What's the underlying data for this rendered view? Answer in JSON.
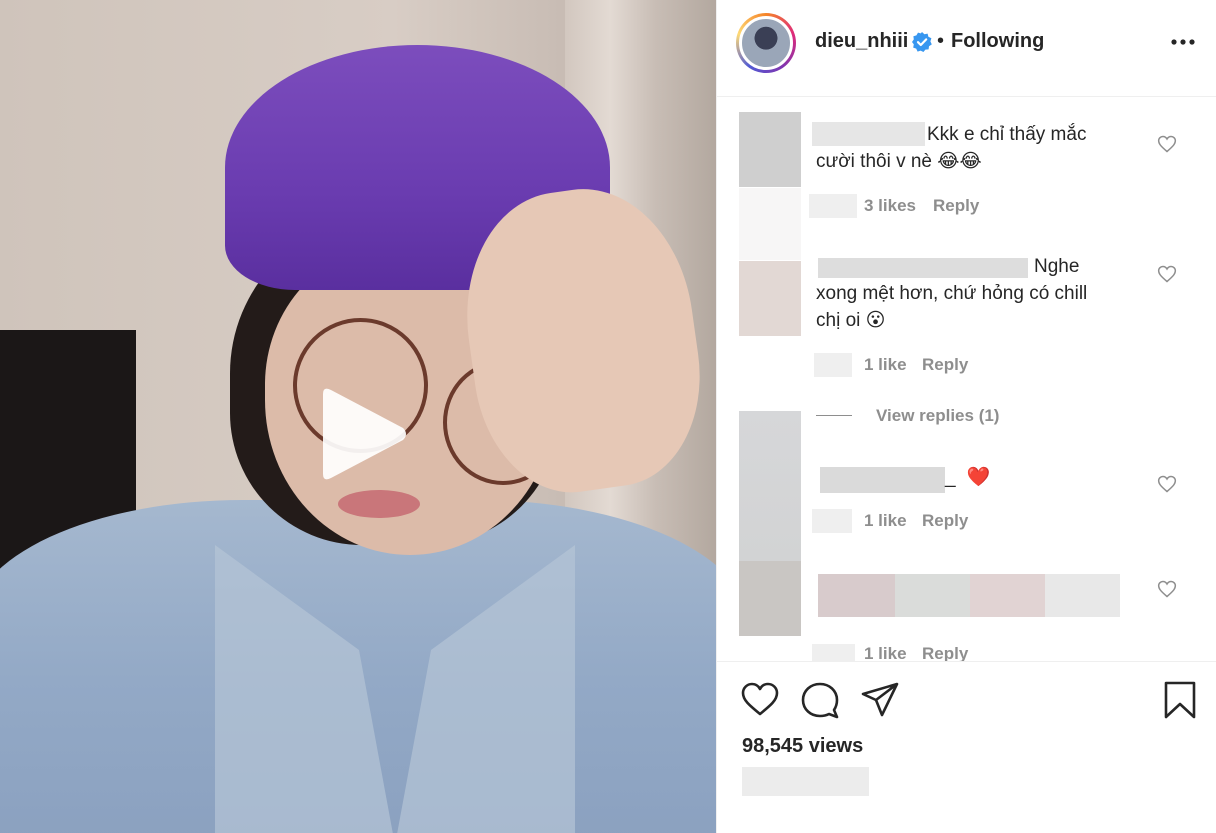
{
  "post": {
    "author": "dieu_nhiii",
    "separator": "•",
    "follow_state": "Following",
    "views": "98,545 views"
  },
  "icons": {
    "play": "play-icon",
    "verified": "verified-badge-icon",
    "more": "more-options-icon",
    "like": "heart-icon",
    "comment": "comment-icon",
    "share": "share-icon",
    "save": "bookmark-icon"
  },
  "colors": {
    "verified": "#3897f0",
    "text": "#262626",
    "secondary": "#8e8e8e",
    "border": "#efefef",
    "heart_emoji": "#ed4956"
  },
  "comments": [
    {
      "text_line1": "Kkk e chỉ thấy mắc",
      "text_line2": "cười thôi v nè",
      "emojis": "😂😂",
      "likes": "3 likes",
      "reply": "Reply"
    },
    {
      "text_line1": "Nghe",
      "text_line2": "xong mệt hơn, chứ hỏng có chill",
      "text_line3": "chị oi",
      "emojis": "😮",
      "likes": "1 like",
      "reply": "Reply"
    },
    {
      "view_replies": "View replies (1)"
    },
    {
      "text_line1": "_",
      "emojis": "❤️",
      "likes": "1 like",
      "reply": "Reply"
    },
    {
      "likes": "1 like",
      "reply": "Reply"
    }
  ]
}
